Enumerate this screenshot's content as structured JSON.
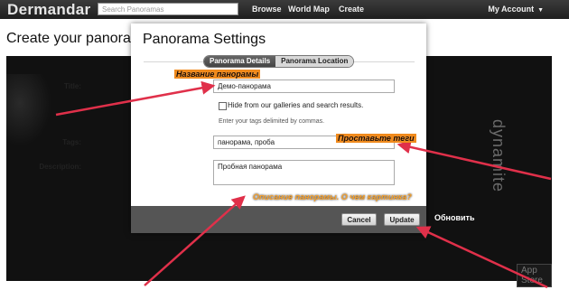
{
  "app": {
    "brand": "Dermandar",
    "search_placeholder": "Search Panoramas",
    "nav": {
      "browse": "Browse",
      "world_map": "World Map",
      "create": "Create"
    },
    "account": "My Account"
  },
  "page": {
    "title": "Create your panoram"
  },
  "background": {
    "brand_vertical": "dynamite",
    "store_badge": "App Store"
  },
  "modal": {
    "title": "Panorama Settings",
    "tabs": [
      {
        "label": "Panorama Details",
        "active": true
      },
      {
        "label": "Panorama Location",
        "active": false
      }
    ],
    "fields": {
      "title_label": "Title:",
      "title_value": "Демо-панорама",
      "hide_label": "Hide from our galleries and search results.",
      "hide_checked": false,
      "tags_hint": "Enter your tags delimited by commas.",
      "tags_label": "Tags:",
      "tags_value": "панорама, проба",
      "description_label": "Description:",
      "description_value": "Пробная панорама"
    },
    "buttons": {
      "cancel": "Cancel",
      "update": "Update"
    }
  },
  "annotations": {
    "title_name": "Название панорамы",
    "tags": "Проставьте теги",
    "description": "Описание панорамы. О чем картинка?",
    "update": "Обновить"
  },
  "colors": {
    "annotation_orange": "#f08a1c",
    "arrow_red": "#e0304a",
    "topbar": "#2b2b2b",
    "footer": "#555555"
  }
}
